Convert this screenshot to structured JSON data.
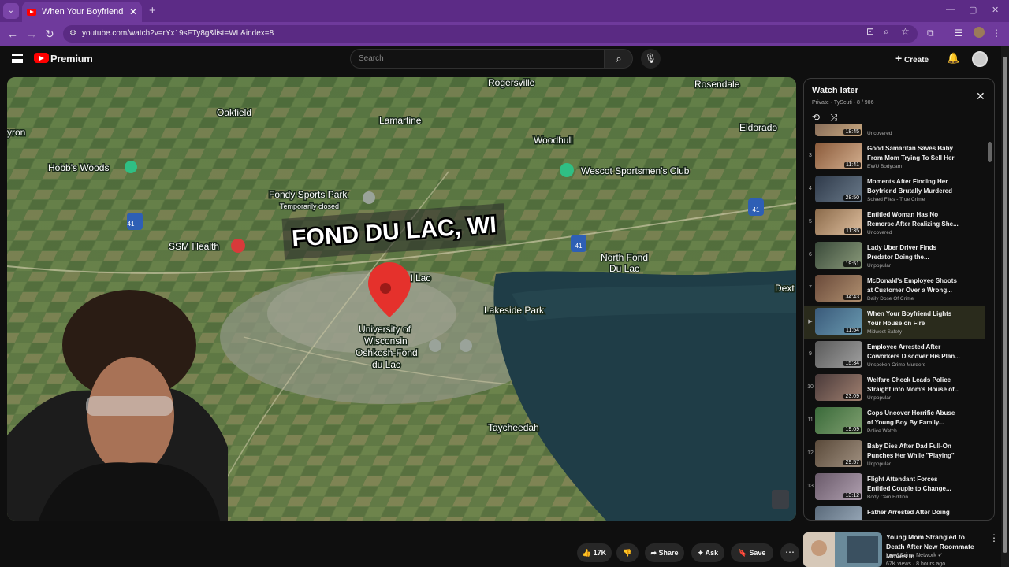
{
  "browser": {
    "tab_title": "When Your Boyfriend Lights Yo",
    "url": "youtube.com/watch?v=rYx19sFTy8g&list=WL&index=8"
  },
  "header": {
    "brand": "Premium",
    "search_placeholder": "Search",
    "create_label": "Create"
  },
  "video": {
    "overlay_title": "FOND DU LAC, WI",
    "map_labels": {
      "rogersville": "Rogersville",
      "rosendale": "Rosendale",
      "oakfield": "Oakfield",
      "lamartine": "Lamartine",
      "eldorado": "Eldorado",
      "woodhull": "Woodhull",
      "hobbs_woods": "Hobb's Woods",
      "wescot": "Wescot Sportsmen's Club",
      "fondy_sports": "Fondy Sports Park",
      "temp_closed": "Temporarily closed",
      "ssm_health": "SSM Health",
      "north_fond": "North Fond",
      "du_lac": "Du Lac",
      "dext": "Dext",
      "lakeside": "Lakeside Park",
      "fond_lac": "l Lac",
      "uw1": "University of",
      "uw2": "Wisconsin",
      "uw3": "Oshkosh-Fond",
      "uw4": "du Lac",
      "taycheedah": "Taycheedah",
      "yron": "yron",
      "hw41": "41"
    }
  },
  "playlist": {
    "title": "Watch later",
    "meta": "Private · TyScuti · 8 / 906",
    "items": [
      {
        "index": "",
        "title": "",
        "channel": "Uncovered",
        "duration": "18:45"
      },
      {
        "index": "3",
        "title": "Good Samaritan Saves Baby From Mom Trying To Sell Her",
        "channel": "EWU Bodycam",
        "duration": "11:41"
      },
      {
        "index": "4",
        "title": "Moments After Finding Her Boyfriend Brutally Murdered",
        "channel": "Solved Files - True Crime",
        "duration": "28:50"
      },
      {
        "index": "5",
        "title": "Entitled Woman Has No Remorse After Realizing She...",
        "channel": "Uncovered",
        "duration": "11:35"
      },
      {
        "index": "6",
        "title": "Lady Uber Driver Finds Predator Doing the...",
        "channel": "Unpopular",
        "duration": "19:51"
      },
      {
        "index": "7",
        "title": "McDonald's Employee Shoots at Customer Over a Wrong...",
        "channel": "Daily Dose Of Crime",
        "duration": "34:43"
      },
      {
        "index": "▶",
        "title": "When Your Boyfriend Lights Your House on Fire",
        "channel": "Midwest Safety",
        "duration": "11:54"
      },
      {
        "index": "9",
        "title": "Employee Arrested After Coworkers Discover His Plan...",
        "channel": "Unspoken Crime Murders",
        "duration": "15:34"
      },
      {
        "index": "10",
        "title": "Welfare Check Leads Police Straight into Mom's House of...",
        "channel": "Unpopular",
        "duration": "23:09"
      },
      {
        "index": "11",
        "title": "Cops Uncover Horrific Abuse of Young Boy By Family...",
        "channel": "Police Watch",
        "duration": "19:09"
      },
      {
        "index": "12",
        "title": "Baby Dies After Dad Full-On Punches Her While \"Playing\"",
        "channel": "Unpopular",
        "duration": "29:57"
      },
      {
        "index": "13",
        "title": "Flight Attendant Forces Entitled Couple to Change...",
        "channel": "Body Cam Edition",
        "duration": "13:12"
      },
      {
        "index": "",
        "title": "Father Arrested After Doing",
        "channel": "",
        "duration": ""
      }
    ]
  },
  "actions": {
    "likes": "17K",
    "share": "Share",
    "ask": "Ask",
    "save": "Save"
  },
  "recommendation": {
    "title": "Young Mom Strangled to Death After New Roommate Moves In",
    "channel": "Law&Crime Network",
    "views": "67K views · 8 hours ago"
  },
  "colors": {
    "browser_frame": "#5c2b86",
    "brand_red": "#ff0000",
    "active_row": "#2a2b1c"
  }
}
